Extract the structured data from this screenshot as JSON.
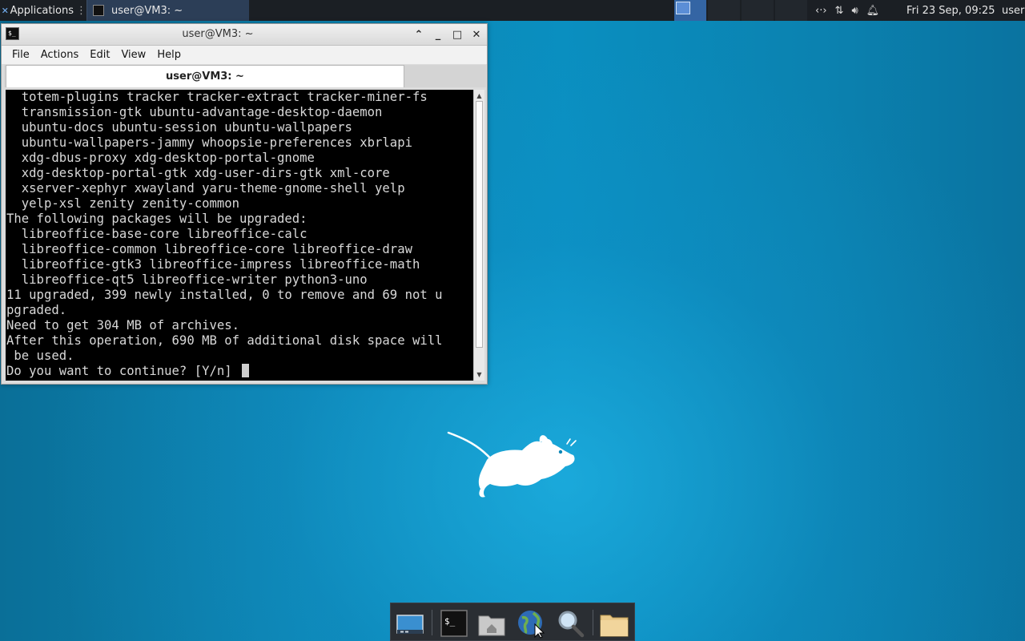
{
  "top_panel": {
    "applications_label": "Applications",
    "task_title": "user@VM3: ~",
    "clock": "Fri 23 Sep, 09:25",
    "user": "user"
  },
  "terminal": {
    "title": "user@VM3: ~",
    "menu": [
      "File",
      "Actions",
      "Edit",
      "View",
      "Help"
    ],
    "tab_title": "user@VM3: ~",
    "lines": [
      "  totem-plugins tracker tracker-extract tracker-miner-fs",
      "  transmission-gtk ubuntu-advantage-desktop-daemon",
      "  ubuntu-docs ubuntu-session ubuntu-wallpapers",
      "  ubuntu-wallpapers-jammy whoopsie-preferences xbrlapi",
      "  xdg-dbus-proxy xdg-desktop-portal-gnome",
      "  xdg-desktop-portal-gtk xdg-user-dirs-gtk xml-core",
      "  xserver-xephyr xwayland yaru-theme-gnome-shell yelp",
      "  yelp-xsl zenity zenity-common",
      "The following packages will be upgraded:",
      "  libreoffice-base-core libreoffice-calc",
      "  libreoffice-common libreoffice-core libreoffice-draw",
      "  libreoffice-gtk3 libreoffice-impress libreoffice-math",
      "  libreoffice-qt5 libreoffice-writer python3-uno",
      "11 upgraded, 399 newly installed, 0 to remove and 69 not u",
      "pgraded.",
      "Need to get 304 MB of archives.",
      "After this operation, 690 MB of additional disk space will",
      " be used."
    ],
    "prompt": "Do you want to continue? [Y/n] "
  },
  "icons": {
    "apps": "xfce-logo-icon",
    "tray": [
      "network-icon",
      "transfer-icon",
      "volume-icon",
      "notification-bell-icon"
    ],
    "dock": [
      "show-desktop-icon",
      "terminal-icon",
      "home-folder-icon",
      "web-browser-icon",
      "search-icon",
      "files-icon"
    ]
  },
  "colors": {
    "panel_bg": "#1b1f24",
    "active_task": "#2c3e57",
    "workspace_active": "#3465a4",
    "terminal_bg": "#000000",
    "terminal_fg": "#d8d8d8"
  }
}
